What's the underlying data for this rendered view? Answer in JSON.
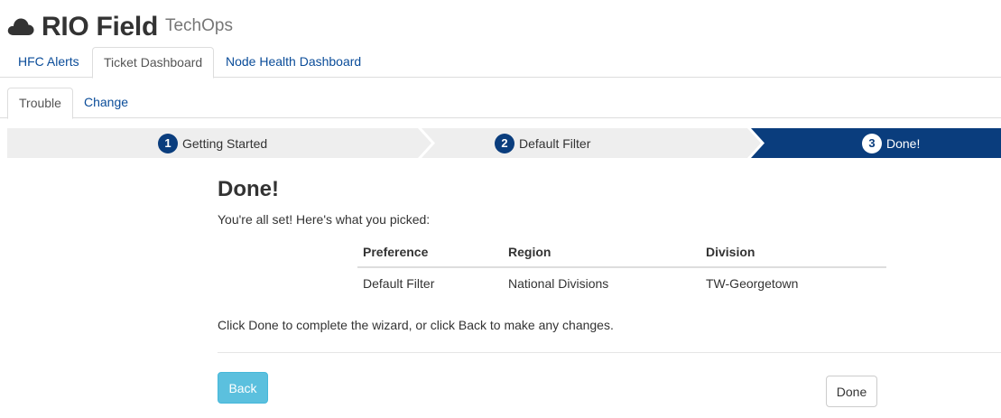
{
  "app": {
    "title": "RIO Field",
    "subtitle": "TechOps",
    "logo_icon": "cloud-icon"
  },
  "main_tabs": [
    {
      "label": "HFC Alerts",
      "active": false
    },
    {
      "label": "Ticket Dashboard",
      "active": true
    },
    {
      "label": "Node Health Dashboard",
      "active": false
    }
  ],
  "sub_tabs": [
    {
      "label": "Trouble",
      "active": true
    },
    {
      "label": "Change",
      "active": false
    }
  ],
  "wizard": {
    "steps": [
      {
        "number": "1",
        "label": "Getting Started",
        "active": false
      },
      {
        "number": "2",
        "label": "Default Filter",
        "active": false
      },
      {
        "number": "3",
        "label": "Done!",
        "active": true
      }
    ],
    "colors": {
      "inactive": "#eeeeee",
      "active": "#0a3d7d"
    }
  },
  "done_panel": {
    "title": "Done!",
    "intro": "You're all set! Here's what you picked:",
    "table": {
      "headers": [
        "Preference",
        "Region",
        "Division"
      ],
      "rows": [
        [
          "Default Filter",
          "National Divisions",
          "TW-Georgetown"
        ]
      ]
    },
    "outro": "Click Done to complete the wizard, or click Back to make any changes."
  },
  "buttons": {
    "back": "Back",
    "done": "Done"
  },
  "colors": {
    "link": "#0a4c99",
    "info_button": "#5bc0de"
  }
}
